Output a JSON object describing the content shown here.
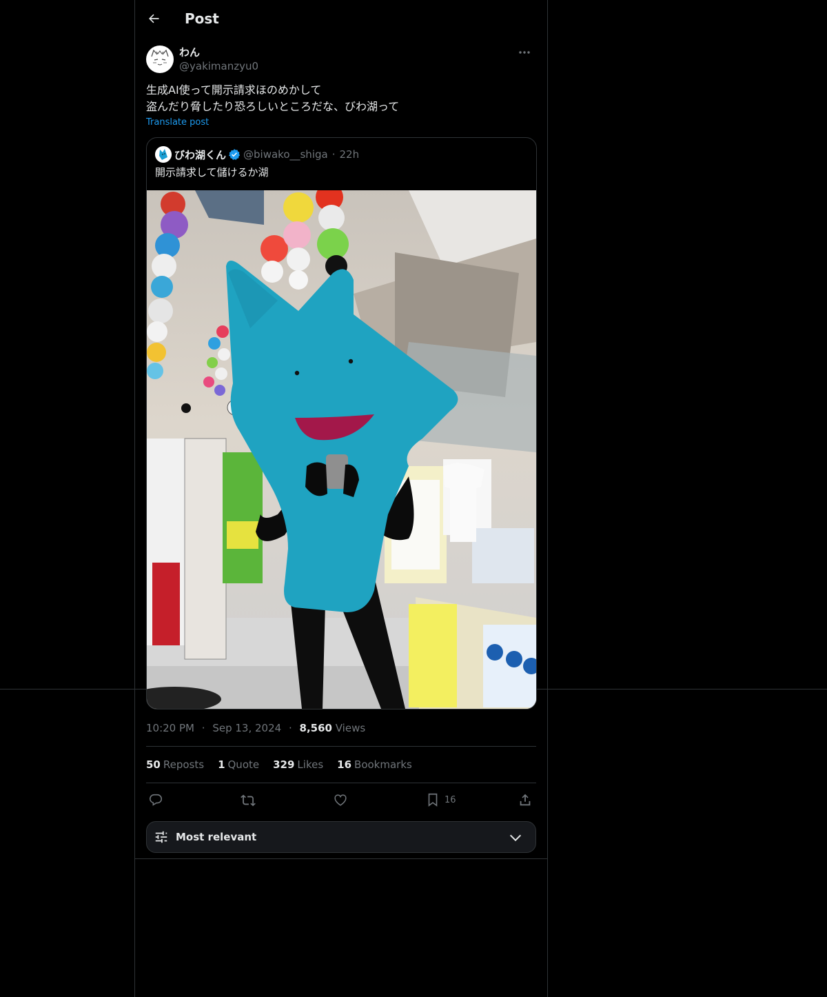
{
  "header": {
    "title": "Post"
  },
  "post": {
    "author": {
      "display_name": "わん",
      "handle": "@yakimanzyu0"
    },
    "text_lines": [
      "生成AI使って開示請求ほのめかして",
      "盗んだり脅したり恐ろしいところだな、びわ湖って"
    ],
    "translate_label": "Translate post",
    "quote": {
      "display_name": "びわ湖くん",
      "handle": "@biwako__shiga",
      "separator": "·",
      "time": "22h",
      "text": "開示請求して儲けるか湖"
    },
    "time": "10:20 PM",
    "date": "Sep 13, 2024",
    "dot": "·",
    "views_count": "8,560",
    "views_label": "Views",
    "stats": {
      "reposts_count": "50",
      "reposts_label": "Reposts",
      "quotes_count": "1",
      "quotes_label": "Quote",
      "likes_count": "329",
      "likes_label": "Likes",
      "bookmarks_count": "16",
      "bookmarks_label": "Bookmarks"
    },
    "actions": {
      "reply_icon": "reply-icon",
      "repost_icon": "repost-icon",
      "like_icon": "heart-icon",
      "bookmark_icon": "bookmark-icon",
      "bookmark_count": "16",
      "share_icon": "share-icon"
    }
  },
  "replies_sort": {
    "label": "Most relevant"
  },
  "colors": {
    "background": "#000000",
    "text": "#e7e9ea",
    "muted": "#71767b",
    "accent": "#1d9bf0",
    "border": "#2f3336"
  }
}
